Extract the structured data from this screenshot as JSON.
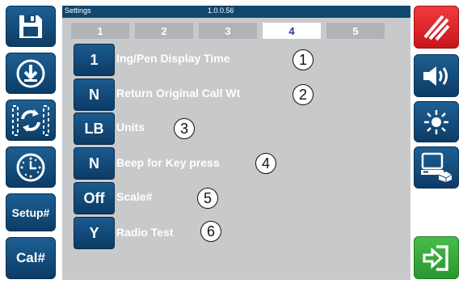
{
  "titlebar": {
    "title": "Settings",
    "version": "1.0.0.56"
  },
  "tabs": [
    {
      "label": "1",
      "active": false
    },
    {
      "label": "2",
      "active": false
    },
    {
      "label": "3",
      "active": false
    },
    {
      "label": "4",
      "active": true
    },
    {
      "label": "5",
      "active": false
    }
  ],
  "left_sidebar": {
    "save_icon": "floppy-disk-icon",
    "download_icon": "download-icon",
    "sync_icon": "sync-icon",
    "clock_icon": "clock-icon",
    "setup_label": "Setup#",
    "cal_label": "Cal#"
  },
  "right_sidebar": {
    "cancel_icon": "slash-cancel-icon",
    "volume_icon": "speaker-icon",
    "brightness_icon": "brightness-icon",
    "device_icon": "computer-device-icon",
    "enter_icon": "enter-arrow-icon"
  },
  "settings": [
    {
      "value": "1",
      "label": "Ing/Pen Display Time",
      "callout": "1"
    },
    {
      "value": "N",
      "label": "Return Original Call Wt",
      "callout": "2"
    },
    {
      "value": "LB",
      "label": "Units",
      "callout": "3"
    },
    {
      "value": "N",
      "label": "Beep for Key press",
      "callout": "4"
    },
    {
      "value": "Off",
      "label": "Scale#",
      "callout": "5"
    },
    {
      "value": "Y",
      "label": "Radio Test",
      "callout": "6"
    }
  ],
  "colors": {
    "primary_blue": "#0f4a7a",
    "panel_gray": "#c8c9cb",
    "cancel_red": "#e0262c",
    "enter_green": "#36a83a",
    "active_tab_text": "#1b3ea8"
  }
}
